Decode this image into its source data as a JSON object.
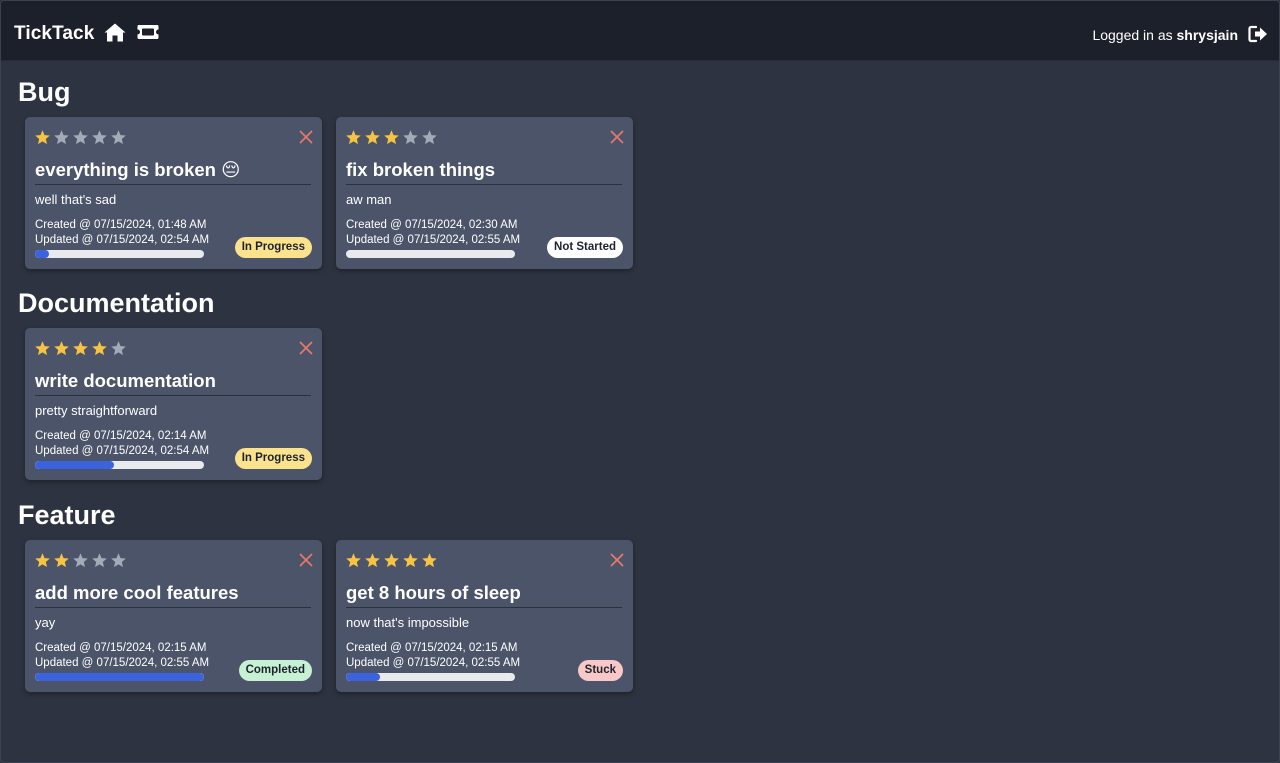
{
  "app": {
    "brand": "TickTack",
    "login_prefix": "Logged in as",
    "username": "shrysjain"
  },
  "colors": {
    "star_on": "#f6c343",
    "star_off": "#a3aab8",
    "close": "#e5786a",
    "progress_fill": "#3b63e0"
  },
  "categories": [
    {
      "name": "Bug",
      "tickets": [
        {
          "rating": 1,
          "title": "everything is broken 😔",
          "description": "well that's sad",
          "created": "Created @ 07/15/2024, 01:48 AM",
          "updated": "Updated @ 07/15/2024, 02:54 AM",
          "progress_percent": 8,
          "status": "In Progress",
          "status_color": "#fbe38e"
        },
        {
          "rating": 3,
          "title": "fix broken things",
          "description": "aw man",
          "created": "Created @ 07/15/2024, 02:30 AM",
          "updated": "Updated @ 07/15/2024, 02:55 AM",
          "progress_percent": 0,
          "status": "Not Started",
          "status_color": "#ffffff"
        }
      ]
    },
    {
      "name": "Documentation",
      "tickets": [
        {
          "rating": 4,
          "title": "write documentation",
          "description": "pretty straightforward",
          "created": "Created @ 07/15/2024, 02:14 AM",
          "updated": "Updated @ 07/15/2024, 02:54 AM",
          "progress_percent": 47,
          "status": "In Progress",
          "status_color": "#fbe38e"
        }
      ]
    },
    {
      "name": "Feature",
      "tickets": [
        {
          "rating": 2,
          "title": "add more cool features",
          "description": "yay",
          "created": "Created @ 07/15/2024, 02:15 AM",
          "updated": "Updated @ 07/15/2024, 02:55 AM",
          "progress_percent": 100,
          "status": "Completed",
          "status_color": "#c6f1d3"
        },
        {
          "rating": 5,
          "title": "get 8 hours of sleep",
          "description": "now that's impossible",
          "created": "Created @ 07/15/2024, 02:15 AM",
          "updated": "Updated @ 07/15/2024, 02:55 AM",
          "progress_percent": 20,
          "status": "Stuck",
          "status_color": "#f8c7c7"
        }
      ]
    }
  ]
}
